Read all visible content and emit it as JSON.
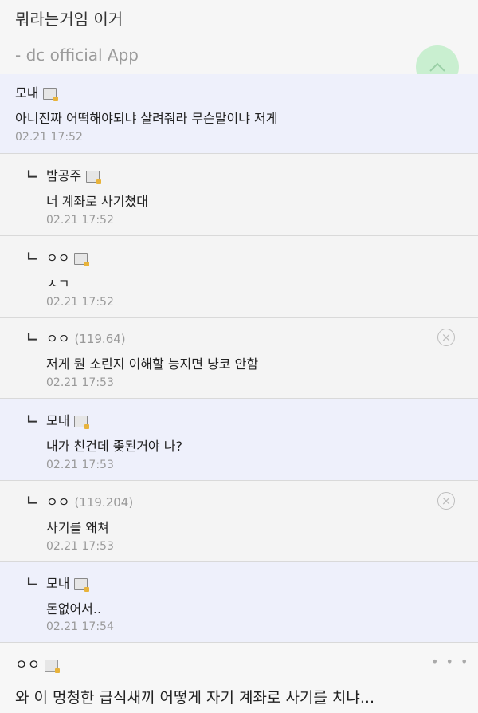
{
  "post": {
    "title": "뭐라는거임 이거",
    "signature": "- dc official App"
  },
  "comments": [
    {
      "nick": "모내",
      "ip": "",
      "body": "아니진짜 어떡해야되냐 살려줘라 무슨말이냐 저게",
      "date": "02.21 17:52"
    },
    {
      "nick": "밤공주",
      "ip": "",
      "body": "너 계좌로 사기쳤대",
      "date": "02.21 17:52"
    },
    {
      "nick": "ㅇㅇ",
      "ip": "",
      "body": "ㅅㄱ",
      "date": "02.21 17:52"
    },
    {
      "nick": "ㅇㅇ",
      "ip": "(119.64)",
      "body": "저게 뭔 소린지 이해할 능지면 냥코 안함",
      "date": "02.21 17:53"
    },
    {
      "nick": "모내",
      "ip": "",
      "body": "내가 친건데 좆된거야 나?",
      "date": "02.21 17:53"
    },
    {
      "nick": "ㅇㅇ",
      "ip": "(119.204)",
      "body": "사기를 왜쳐",
      "date": "02.21 17:53"
    },
    {
      "nick": "모내",
      "ip": "",
      "body": "돈없어서..",
      "date": "02.21 17:54"
    }
  ],
  "reply_mark": "ㄴ",
  "delete_glyph": "×",
  "bottom": {
    "nick": "ㅇㅇ",
    "more": "• • •",
    "text": "와 이 멍청한 급식새끼 어떻게 자기 계좌로 사기를 치냐..."
  }
}
